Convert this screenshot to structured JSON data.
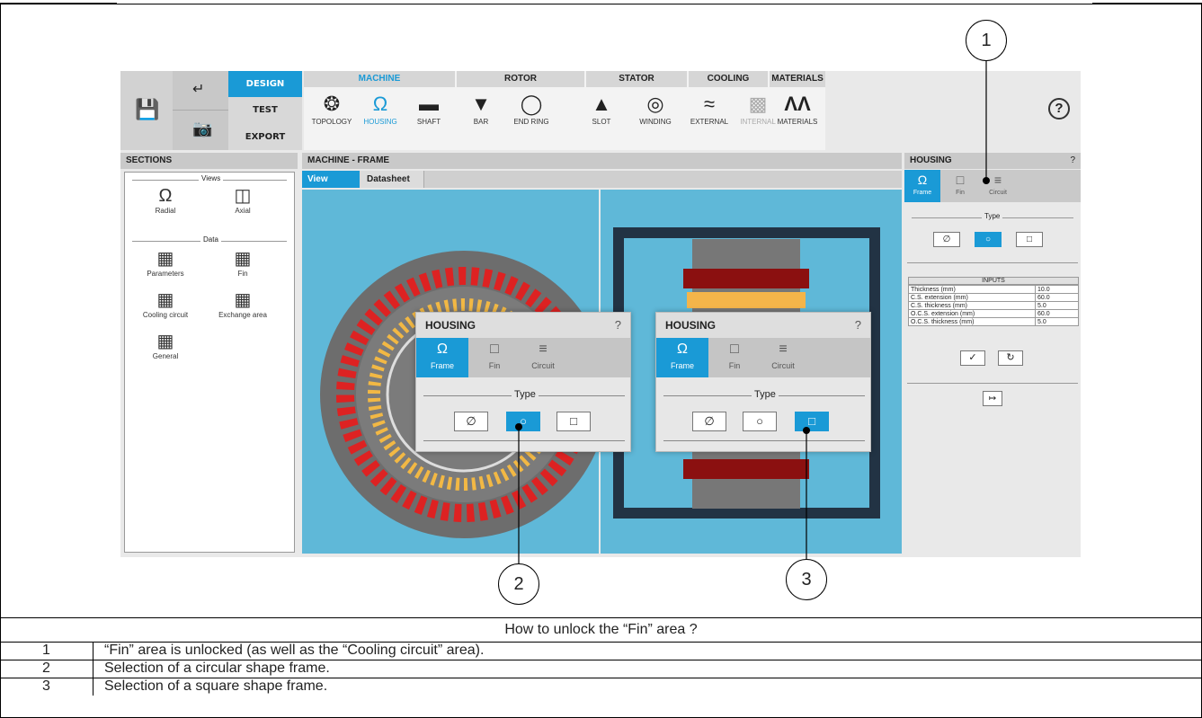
{
  "toolbar": {
    "mode_design": "DESIGN",
    "mode_test": "TEST",
    "mode_export": "EXPORT",
    "groups": [
      "MACHINE",
      "ROTOR",
      "STATOR",
      "COOLING",
      "MATERIALS"
    ],
    "tools": [
      "TOPOLOGY",
      "HOUSING",
      "SHAFT",
      "BAR",
      "END RING",
      "SLOT",
      "WINDING",
      "EXTERNAL",
      "INTERNAL",
      "MATERIALS"
    ],
    "help": "?"
  },
  "sections": {
    "title": "SECTIONS",
    "views_label": "Views",
    "data_label": "Data",
    "radial": "Radial",
    "axial": "Axial",
    "parameters": "Parameters",
    "fin": "Fin",
    "cooling_circuit": "Cooling circuit",
    "exchange_area": "Exchange area",
    "general": "General"
  },
  "main": {
    "title": "MACHINE - FRAME",
    "tab_view": "View",
    "tab_datasheet": "Datasheet"
  },
  "housing": {
    "title": "HOUSING",
    "help": "?",
    "tab_frame": "Frame",
    "tab_fin": "Fin",
    "tab_circuit": "Circuit",
    "type_label": "Type",
    "inputs_title": "INPUTS",
    "inputs": [
      {
        "label": "Thickness (mm)",
        "value": "10.0"
      },
      {
        "label": "C.S. extension (mm)",
        "value": "60.0"
      },
      {
        "label": "C.S. thickness (mm)",
        "value": "5.0"
      },
      {
        "label": "O.C.S. extension (mm)",
        "value": "60.0"
      },
      {
        "label": "O.C.S. thickness (mm)",
        "value": "5.0"
      }
    ]
  },
  "callouts": [
    "1",
    "2",
    "3"
  ],
  "caption": {
    "title": "How to unlock the “Fin” area ?",
    "rows": [
      {
        "num": "1",
        "text": "“Fin” area is unlocked (as well as the “Cooling circuit” area)."
      },
      {
        "num": "2",
        "text": "Selection of a circular shape frame."
      },
      {
        "num": "3",
        "text": "Selection of a square shape frame."
      }
    ]
  },
  "colors": {
    "accent": "#1a9ad6",
    "canvas": "#5fb8d8"
  }
}
